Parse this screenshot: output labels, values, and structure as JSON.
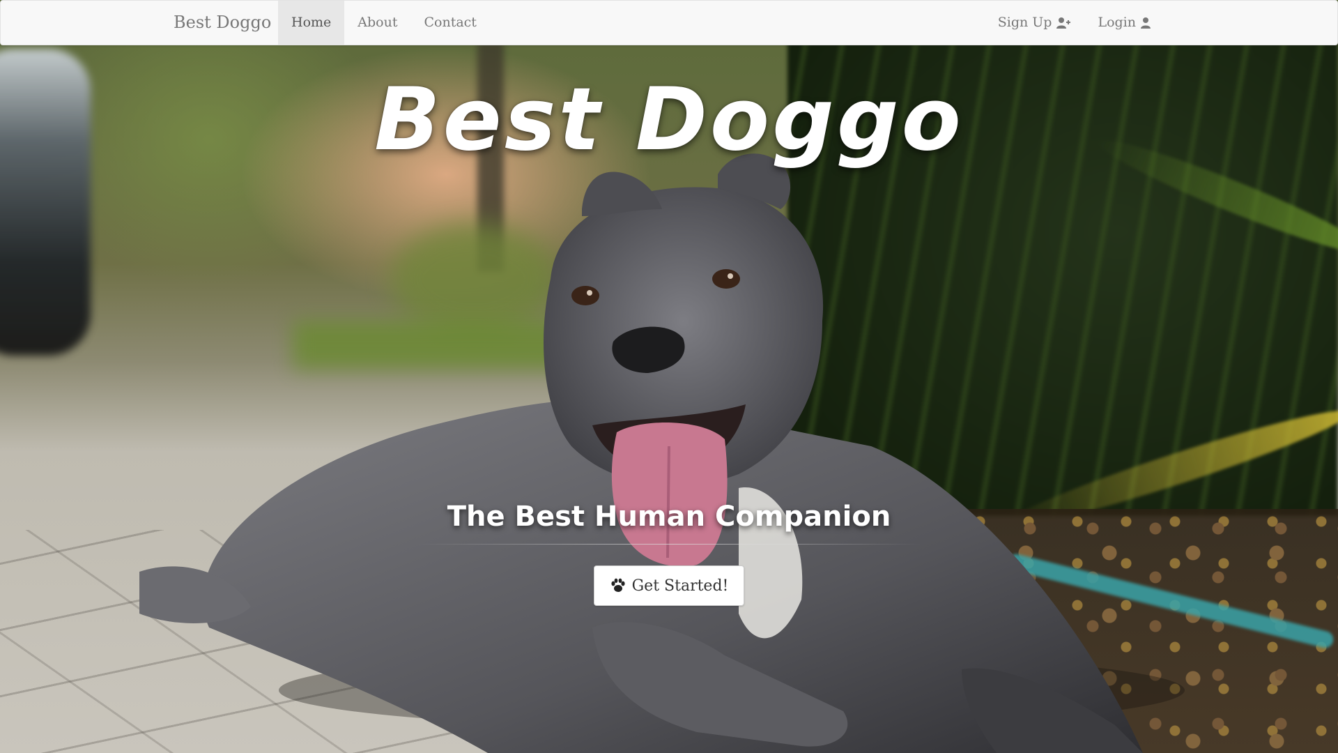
{
  "navbar": {
    "brand": "Best Doggo",
    "left_items": [
      {
        "label": "Home",
        "active": true
      },
      {
        "label": "About",
        "active": false
      },
      {
        "label": "Contact",
        "active": false
      }
    ],
    "right_items": [
      {
        "label": "Sign Up",
        "icon": "user-plus-icon"
      },
      {
        "label": "Login",
        "icon": "user-icon"
      }
    ]
  },
  "hero": {
    "title": "Best Doggo",
    "subtitle": "The Best Human Companion",
    "cta_label": "Get Started!",
    "cta_icon": "paw-icon",
    "background": "photo of a grey pit bull lying on pavement with tongue out"
  },
  "colors": {
    "navbar_bg": "#f8f8f8",
    "nav_text": "#777777",
    "nav_active_bg": "#e7e7e7",
    "hero_text": "#ffffff",
    "button_bg": "#ffffff"
  }
}
